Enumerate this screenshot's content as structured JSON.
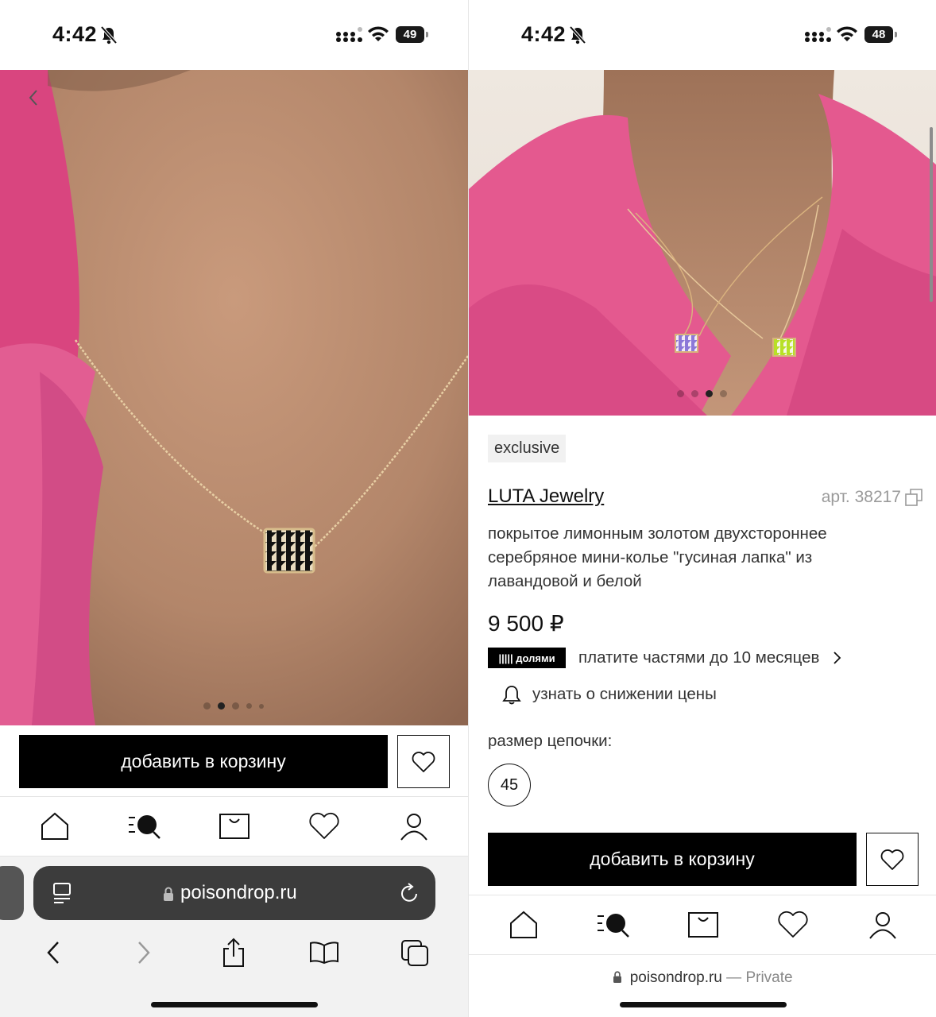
{
  "left": {
    "status": {
      "time": "4:42",
      "battery": "49"
    },
    "photo": {
      "dots": 5,
      "active_dot": 1
    },
    "cart": {
      "add_label": "добавить в корзину"
    },
    "nav": [
      "home",
      "catalog-search",
      "bag",
      "favorites",
      "profile"
    ],
    "safari": {
      "url": "poisondrop.ru"
    }
  },
  "right": {
    "status": {
      "time": "4:42",
      "battery": "48"
    },
    "photo": {
      "dots": 4,
      "active_dot": 2
    },
    "product": {
      "badge": "exclusive",
      "brand": "LUTA Jewelry",
      "article": "арт. 38217",
      "description": "покрытое лимонным золотом двухстороннее серебряное мини-колье \"гусиная лапка\" из лавандовой и белой",
      "price": "9 500 ₽",
      "installments_badge": "||||| долями",
      "installments_text": "платите частями до 10 месяцев",
      "price_alert": "узнать о снижении цены",
      "size_label": "размер цепочки:",
      "size_value": "45"
    },
    "cart": {
      "add_label": "добавить в корзину"
    },
    "safari": {
      "url": "poisondrop.ru",
      "private": "— Private"
    }
  },
  "colors": {
    "jacket_pink": "#e0568a",
    "skin": "#b88a6e",
    "button_black": "#000000"
  }
}
